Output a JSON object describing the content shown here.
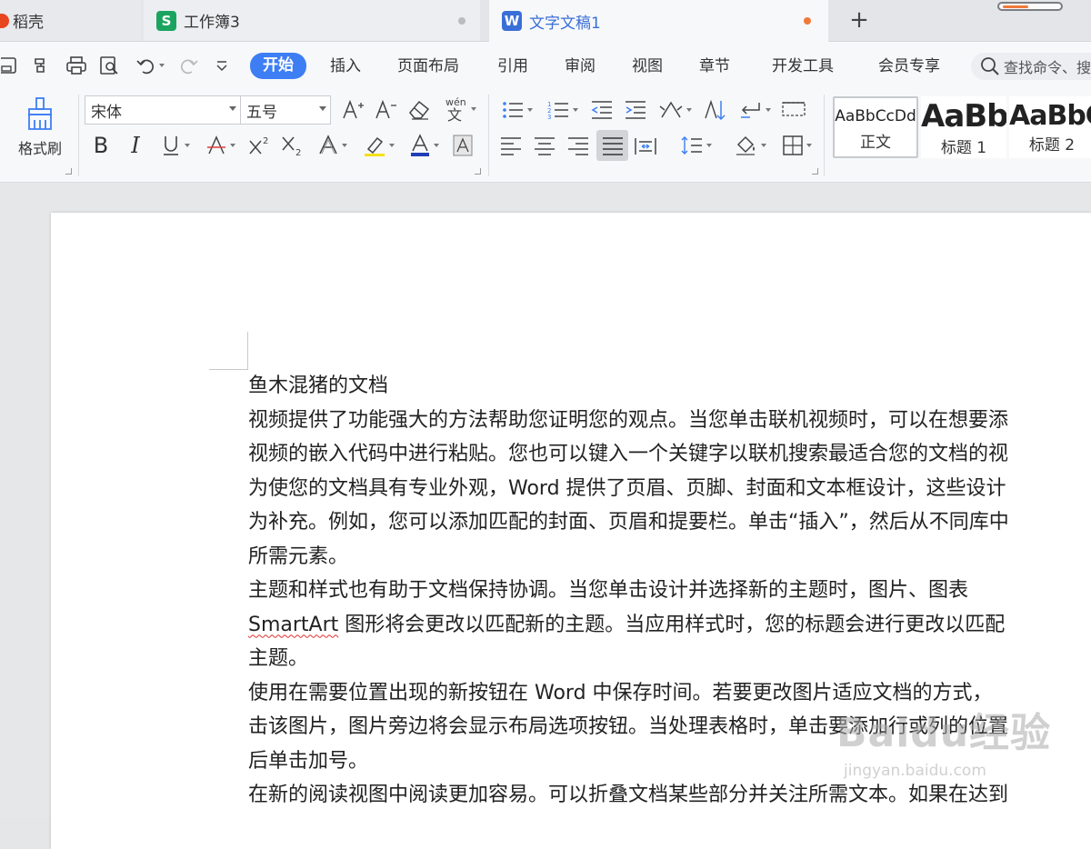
{
  "tabs": [
    {
      "label": "稻壳",
      "color": "#e8461e"
    },
    {
      "label": "工作簿3",
      "icon_letter": "S",
      "color": "#1aa45f"
    },
    {
      "label": "文字文稿1",
      "icon_letter": "W",
      "color": "#3a6fd8",
      "modified_dot": "#f07a3a"
    }
  ],
  "new_tab_glyph": "+",
  "menu": [
    "开始",
    "插入",
    "页面布局",
    "引用",
    "审阅",
    "视图",
    "章节",
    "开发工具",
    "会员专享"
  ],
  "search_placeholder": "查找命令、搜",
  "ribbon": {
    "format_painter": "格式刷",
    "font_name": "宋体",
    "font_size": "五号",
    "styles": [
      {
        "sample": "AaBbCcDd",
        "name": "正文"
      },
      {
        "sample": "AaBb",
        "name": "标题 1"
      },
      {
        "sample": "AaBbC",
        "name": "标题 2"
      }
    ]
  },
  "document": {
    "title": "鱼木混猪的文档",
    "lines": [
      "视频提供了功能强大的方法帮助您证明您的观点。当您单击联机视频时，可以在想要添",
      "视频的嵌入代码中进行粘贴。您也可以键入一个关键字以联机搜索最适合您的文档的视",
      "为使您的文档具有专业外观，Word 提供了页眉、页脚、封面和文本框设计，这些设计",
      "为补充。例如，您可以添加匹配的封面、页眉和提要栏。单击“插入”，然后从不同库中",
      "所需元素。",
      "主题和样式也有助于文档保持协调。当您单击设计并选择新的主题时，图片、图表",
      "SmartArt 图形将会更改以匹配新的主题。当应用样式时，您的标题会进行更改以匹配",
      "主题。",
      "使用在需要位置出现的新按钮在 Word 中保存时间。若要更改图片适应文档的方式，",
      "击该图片，图片旁边将会显示布局选项按钮。当处理表格时，单击要添加行或列的位置",
      "后单击加号。",
      "在新的阅读视图中阅读更加容易。可以折叠文档某些部分并关注所需文本。如果在达到"
    ],
    "squiggle_word": "SmartArt"
  },
  "watermark": {
    "big": "Baidu经验",
    "small": "jingyan.baidu.com"
  },
  "colors": {
    "accent": "#3d7ef5",
    "font_color_bar": "#1f3fb5",
    "highlight_bar": "#f5e11a",
    "font_effect_bar": "#e23c3c"
  }
}
